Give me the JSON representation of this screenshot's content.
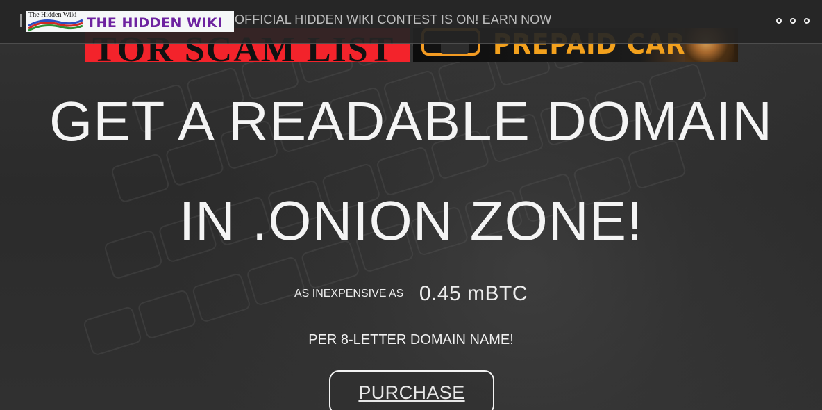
{
  "header": {
    "logo_small_text": "The Hidden Wiki",
    "logo_main_text": "THE HIDDEN WIKI",
    "contest_text": "OFFICIAL HIDDEN WIKI CONTEST IS ON! EARN NOW",
    "menu_icon": "three-dots-icon"
  },
  "ads": {
    "left_banner_text": "TOR SCAM LIST",
    "right_banner_text": "PREPAID CARDS"
  },
  "hero": {
    "headline_line_1": "GET A READABLE DOMAIN",
    "headline_line_2": "IN .ONION ZONE!",
    "price_prefix": "AS INEXPENSIVE AS",
    "price_value": "0.45 mBTC",
    "per_domain_text": "PER 8-LETTER DOMAIN NAME!",
    "purchase_label": "PURCHASE"
  },
  "colors": {
    "header_bg": "#252525",
    "text_primary": "#f4f4f4",
    "brand_purple": "#6d22a0",
    "left_banner_red": "#f3232b",
    "right_banner_orange": "#f39b22"
  }
}
